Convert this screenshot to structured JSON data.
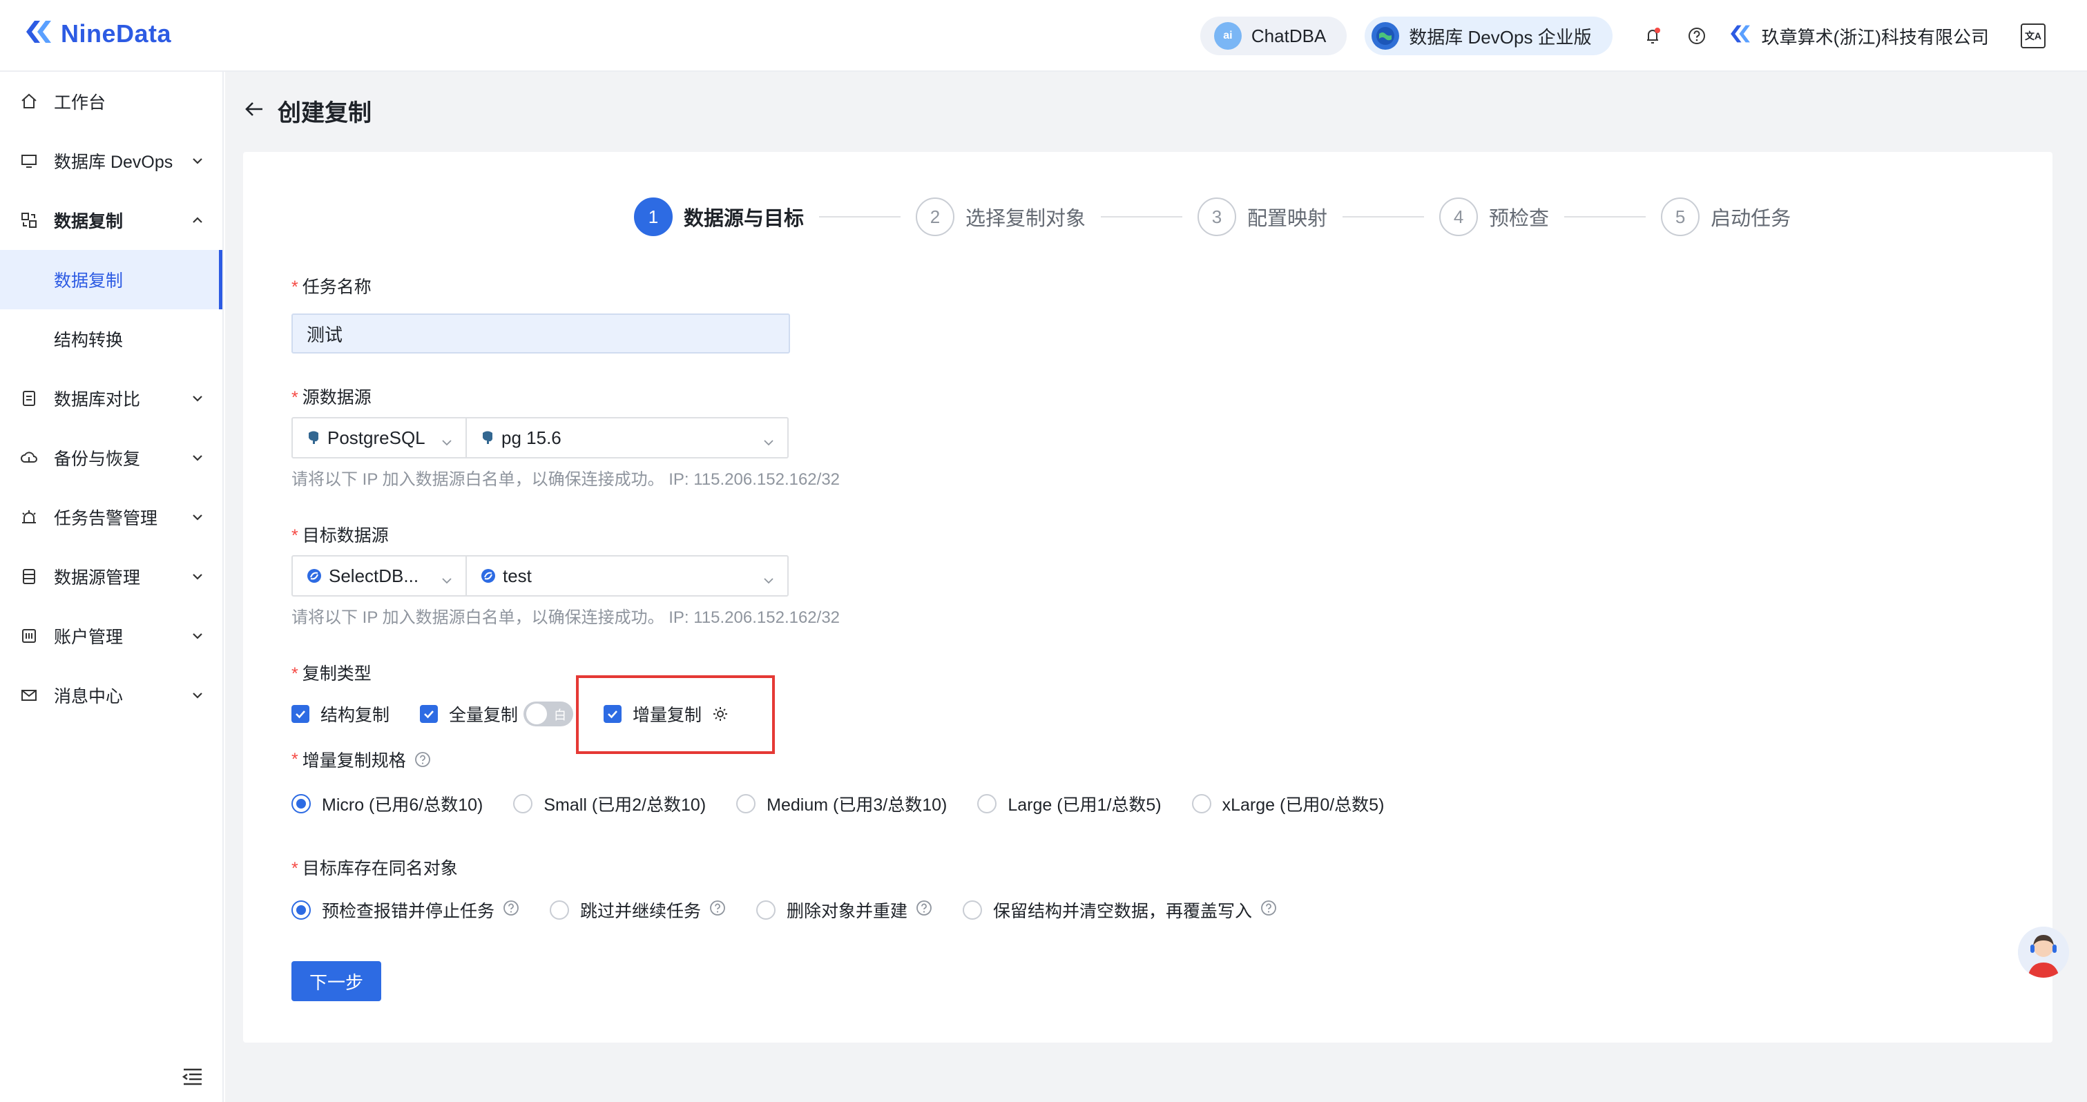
{
  "app": {
    "brand": "NineData"
  },
  "header": {
    "chatdba": {
      "icon": "ai",
      "label": "ChatDBA"
    },
    "devops": {
      "label": "数据库 DevOps 企业版"
    },
    "company": "玖章算术(浙江)科技有限公司",
    "lang_icon": "文A"
  },
  "sidebar": {
    "items": [
      {
        "label": "工作台"
      },
      {
        "label": "数据库 DevOps"
      },
      {
        "label": "数据复制"
      },
      {
        "label": "数据复制"
      },
      {
        "label": "结构转换"
      },
      {
        "label": "数据库对比"
      },
      {
        "label": "备份与恢复"
      },
      {
        "label": "任务告警管理"
      },
      {
        "label": "数据源管理"
      },
      {
        "label": "账户管理"
      },
      {
        "label": "消息中心"
      }
    ]
  },
  "page": {
    "title": "创建复制"
  },
  "steps": [
    {
      "num": "1",
      "label": "数据源与目标"
    },
    {
      "num": "2",
      "label": "选择复制对象"
    },
    {
      "num": "3",
      "label": "配置映射"
    },
    {
      "num": "4",
      "label": "预检查"
    },
    {
      "num": "5",
      "label": "启动任务"
    }
  ],
  "form": {
    "required_mark": "*",
    "task_name": {
      "label": "任务名称",
      "value": "测试"
    },
    "source": {
      "label": "源数据源",
      "type": "PostgreSQL",
      "instance": "pg 15.6",
      "hint": "请将以下 IP 加入数据源白名单，以确保连接成功。 IP: 115.206.152.162/32"
    },
    "target": {
      "label": "目标数据源",
      "type": "SelectDB...",
      "instance": "test",
      "hint": "请将以下 IP 加入数据源白名单，以确保连接成功。 IP: 115.206.152.162/32"
    },
    "replication_type": {
      "label": "复制类型",
      "options": [
        {
          "label": "结构复制",
          "checked": true
        },
        {
          "label": "全量复制",
          "checked": true
        },
        {
          "label": "增量复制",
          "checked": true
        }
      ],
      "toggle_text": "白"
    },
    "incremental_spec": {
      "label": "增量复制规格",
      "options": [
        {
          "label": "Micro (已用6/总数10)",
          "selected": true
        },
        {
          "label": "Small (已用2/总数10)",
          "selected": false
        },
        {
          "label": "Medium (已用3/总数10)",
          "selected": false
        },
        {
          "label": "Large (已用1/总数5)",
          "selected": false
        },
        {
          "label": "xLarge (已用0/总数5)",
          "selected": false
        }
      ]
    },
    "same_name": {
      "label": "目标库存在同名对象",
      "options": [
        {
          "label": "预检查报错并停止任务",
          "selected": true
        },
        {
          "label": "跳过并继续任务",
          "selected": false
        },
        {
          "label": "删除对象并重建",
          "selected": false
        },
        {
          "label": "保留结构并清空数据，再覆盖写入",
          "selected": false
        }
      ]
    },
    "next_button": "下一步"
  },
  "colors": {
    "primary": "#2d6be3",
    "brand": "#2d5be3",
    "highlight": "#e53935",
    "required": "#f54a45"
  }
}
